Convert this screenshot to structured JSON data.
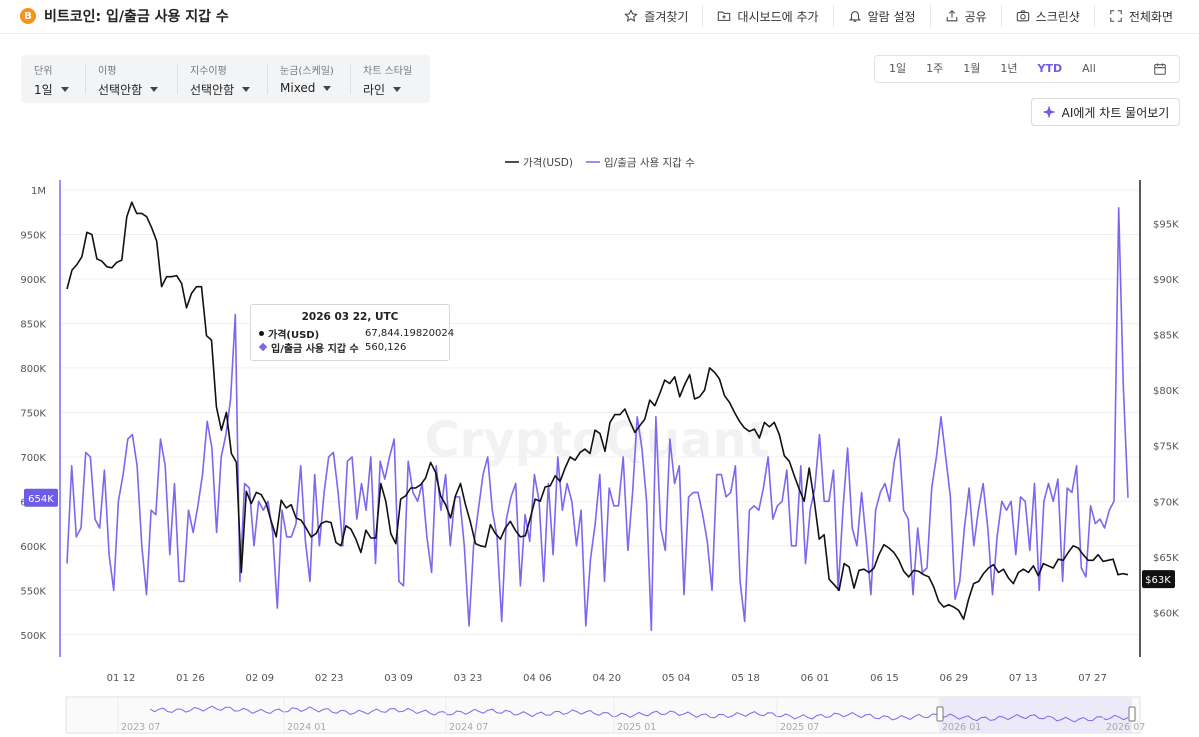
{
  "header": {
    "btc_symbol": "B",
    "title": "비트코인: 입/출금 사용 지갑 수",
    "actions": [
      {
        "label": "즐겨찾기",
        "icon": "star-icon"
      },
      {
        "label": "대시보드에 추가",
        "icon": "folder-plus-icon"
      },
      {
        "label": "알람 설정",
        "icon": "bell-icon"
      },
      {
        "label": "공유",
        "icon": "share-icon"
      },
      {
        "label": "스크린샷",
        "icon": "camera-icon"
      },
      {
        "label": "전체화면",
        "icon": "fullscreen-icon"
      }
    ]
  },
  "controls": [
    {
      "label": "단위",
      "value": "1일"
    },
    {
      "label": "이평",
      "value": "선택안함"
    },
    {
      "label": "지수이평",
      "value": "선택안함"
    },
    {
      "label": "눈금(스케일)",
      "value": "Mixed"
    },
    {
      "label": "차트 스타일",
      "value": "라인"
    }
  ],
  "ranges": [
    "1일",
    "1주",
    "1월",
    "1년",
    "YTD",
    "All"
  ],
  "active_range": "YTD",
  "ai_button": "AI에게 차트 물어보기",
  "tooltip": {
    "title": "2026 03 22, UTC",
    "price_label": "가격(USD)",
    "price_value": "67,844.19820024",
    "wallet_label": "입/출금 사용 지갑 수",
    "wallet_value": "560,126"
  },
  "colors": {
    "price": "#111111",
    "wallets": "#7b68ee",
    "accent": "#6c5ce7"
  },
  "chart_data": {
    "type": "line",
    "legend": [
      "가격(USD)",
      "입/출금 사용 지갑 수"
    ],
    "watermark": "CryptoQuant",
    "x_ticks": [
      "01 12",
      "01 26",
      "02 09",
      "02 23",
      "03 09",
      "03 23",
      "04 06",
      "04 20",
      "05 04",
      "05 18",
      "06 01",
      "06 15",
      "06 29",
      "07 13",
      "07 27"
    ],
    "left_axis": {
      "ticks": [
        "1M",
        "950K",
        "900K",
        "850K",
        "800K",
        "750K",
        "700K",
        "650K",
        "600K",
        "550K",
        "500K"
      ],
      "range": [
        475000,
        1000000
      ],
      "current_label": "654K",
      "current_value": 654000
    },
    "right_axis": {
      "ticks": [
        "$95K",
        "$90K",
        "$85K",
        "$80K",
        "$75K",
        "$70K",
        "$65K",
        "$60K"
      ],
      "range": [
        56000,
        98000
      ],
      "current_label": "$63K",
      "current_value": 63000
    },
    "navigator_labels": [
      "2023 07",
      "2024 01",
      "2024 07",
      "2025 01",
      "2025 07",
      "2026 01",
      "2026 07"
    ],
    "series": [
      {
        "name": "가격(USD)",
        "axis": "right",
        "values": [
          89100,
          90800,
          91300,
          92000,
          94200,
          94000,
          91800,
          91600,
          91100,
          91000,
          91500,
          91700,
          95600,
          96900,
          95900,
          95900,
          95600,
          94600,
          93400,
          89300,
          90200,
          90200,
          90300,
          89600,
          87400,
          88700,
          89300,
          89300,
          84900,
          84500,
          78500,
          76400,
          78000,
          74300,
          73500,
          63600,
          70900,
          69800,
          70800,
          70600,
          69800,
          68200,
          66800,
          70100,
          69400,
          69700,
          68500,
          68300,
          67600,
          66800,
          67100,
          68000,
          68200,
          68100,
          66300,
          66000,
          67800,
          67500,
          66600,
          65400,
          67400,
          66700,
          66700,
          71600,
          70000,
          67100,
          66200,
          70200,
          70500,
          71200,
          71200,
          71500,
          72100,
          73500,
          72600,
          70500,
          69700,
          68500,
          70500,
          71600,
          69700,
          68100,
          66200,
          66000,
          65900,
          67900,
          67100,
          66600,
          67600,
          68200,
          67400,
          66800,
          66900,
          68500,
          70200,
          70000,
          71300,
          71400,
          72300,
          71800,
          73000,
          74000,
          73700,
          74400,
          74700,
          74300,
          76400,
          76100,
          74500,
          77100,
          77800,
          77800,
          78300,
          77200,
          76200,
          76800,
          77400,
          79100,
          78600,
          79700,
          80900,
          80600,
          81200,
          79400,
          80500,
          81400,
          79200,
          79400,
          80000,
          82000,
          81600,
          81000,
          79500,
          78900,
          78000,
          77200,
          76600,
          76300,
          76500,
          75700,
          77100,
          76700,
          77100,
          76000,
          74100,
          73600,
          72300,
          71100,
          70000,
          73000,
          70100,
          66600,
          67000,
          63000,
          62500,
          62000,
          64400,
          64100,
          62200,
          63800,
          63900,
          63600,
          64000,
          65200,
          66100,
          65800,
          65400,
          64700,
          63700,
          63200,
          63800,
          63700,
          63400,
          63200,
          62300,
          61000,
          60500,
          60700,
          60500,
          60200,
          59400,
          61200,
          62600,
          62800,
          63500,
          64000,
          64300,
          63600,
          63900,
          63100,
          62600,
          63600,
          63900,
          63600,
          64200,
          63300,
          64400,
          64200,
          64000,
          64800,
          64700,
          65400,
          66000,
          65800,
          65200,
          64700,
          64700,
          65200,
          64600,
          64700,
          64800,
          63400,
          63500,
          63400
        ]
      },
      {
        "name": "입/출금 사용 지갑 수",
        "axis": "left",
        "values": [
          580000,
          690000,
          610000,
          620000,
          705000,
          700000,
          630000,
          620000,
          685000,
          590000,
          550000,
          650000,
          680000,
          720000,
          725000,
          690000,
          600000,
          545000,
          640000,
          635000,
          720000,
          690000,
          590000,
          670000,
          560000,
          560000,
          640000,
          615000,
          645000,
          680000,
          740000,
          710000,
          615000,
          700000,
          725000,
          765000,
          860000,
          560000,
          670000,
          665000,
          600000,
          650000,
          640000,
          650000,
          615000,
          530000,
          640000,
          610000,
          610000,
          625000,
          690000,
          605000,
          560000,
          680000,
          600000,
          660000,
          700000,
          705000,
          660000,
          600000,
          695000,
          700000,
          630000,
          670000,
          640000,
          700000,
          580000,
          695000,
          675000,
          700000,
          720000,
          560000,
          555000,
          695000,
          660000,
          650000,
          670000,
          610000,
          570000,
          690000,
          640000,
          680000,
          600000,
          655000,
          655000,
          600000,
          510000,
          600000,
          640000,
          680000,
          700000,
          640000,
          610000,
          515000,
          630000,
          655000,
          670000,
          555000,
          635000,
          605000,
          680000,
          650000,
          560000,
          670000,
          590000,
          700000,
          640000,
          670000,
          650000,
          600000,
          640000,
          510000,
          585000,
          625000,
          680000,
          560000,
          665000,
          645000,
          645000,
          700000,
          595000,
          660000,
          745000,
          710000,
          650000,
          505000,
          745000,
          620000,
          595000,
          720000,
          670000,
          690000,
          545000,
          655000,
          660000,
          660000,
          635000,
          605000,
          550000,
          680000,
          680000,
          655000,
          660000,
          690000,
          560000,
          515000,
          640000,
          645000,
          640000,
          665000,
          700000,
          630000,
          645000,
          650000,
          685000,
          600000,
          600000,
          690000,
          580000,
          640000,
          665000,
          725000,
          650000,
          650000,
          685000,
          550000,
          640000,
          710000,
          620000,
          600000,
          660000,
          605000,
          545000,
          640000,
          660000,
          670000,
          650000,
          695000,
          720000,
          640000,
          630000,
          545000,
          620000,
          570000,
          575000,
          665000,
          700000,
          745000,
          700000,
          655000,
          540000,
          560000,
          620000,
          665000,
          600000,
          640000,
          670000,
          620000,
          545000,
          610000,
          650000,
          640000,
          650000,
          590000,
          655000,
          650000,
          595000,
          670000,
          550000,
          650000,
          670000,
          650000,
          675000,
          560000,
          665000,
          660000,
          690000,
          575000,
          565000,
          645000,
          625000,
          630000,
          620000,
          640000,
          650000,
          980000,
          780000,
          654000
        ]
      }
    ],
    "grid": true
  }
}
